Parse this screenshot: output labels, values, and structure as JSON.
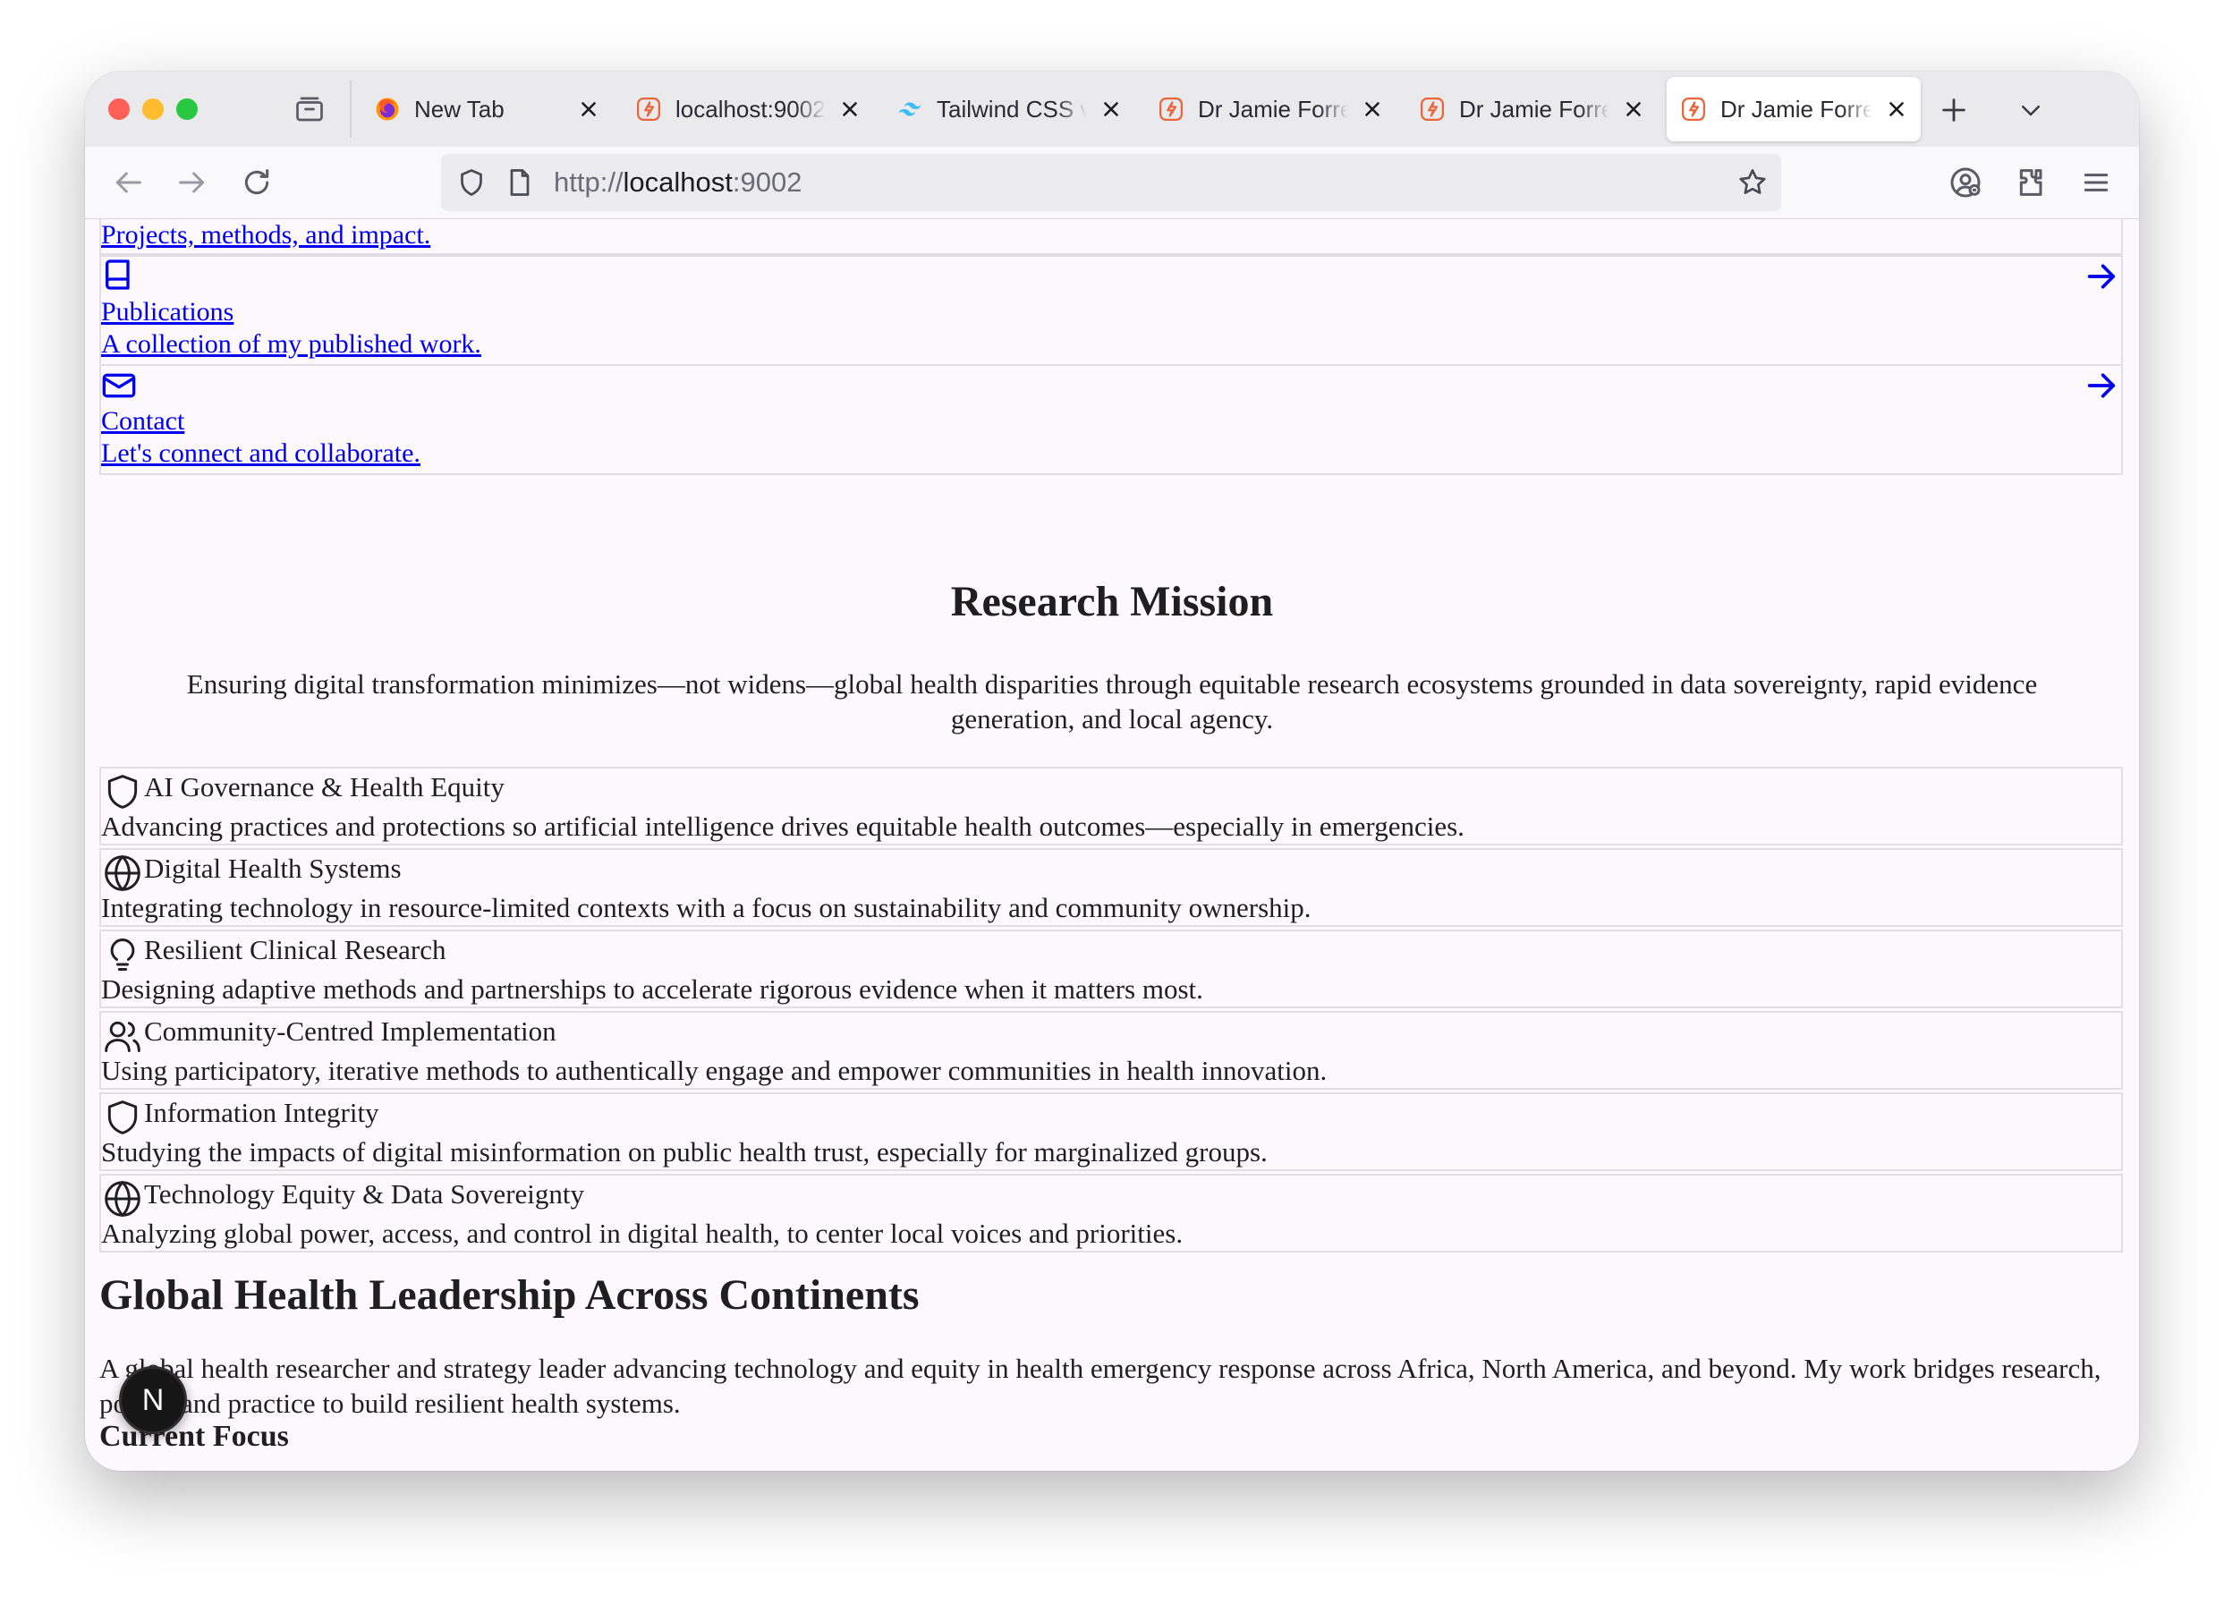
{
  "browser": {
    "tabs": [
      {
        "title": "New Tab",
        "icon": "firefox-icon",
        "active": false
      },
      {
        "title": "localhost:9002",
        "icon": "app-favicon",
        "active": false
      },
      {
        "title": "Tailwind CSS v",
        "icon": "tailwind-icon",
        "active": false
      },
      {
        "title": "Dr Jamie Forre",
        "icon": "app-favicon",
        "active": false
      },
      {
        "title": "Dr Jamie Forre",
        "icon": "app-favicon",
        "active": false
      },
      {
        "title": "Dr Jamie Forre",
        "icon": "app-favicon",
        "active": true
      }
    ],
    "url_scheme": "http://",
    "url_host": "localhost",
    "url_port": ":9002"
  },
  "page": {
    "nav_cards": [
      {
        "title": "",
        "description": "Projects, methods, and impact.",
        "icon": "partial-card",
        "arrow_icon": "arrow-right-icon"
      },
      {
        "title": "Publications",
        "description": "A collection of my published work.",
        "icon": "book-icon",
        "arrow_icon": "arrow-right-icon"
      },
      {
        "title": "Contact",
        "description": "Let's connect and collaborate.",
        "icon": "mail-icon",
        "arrow_icon": "arrow-right-icon"
      }
    ],
    "mission": {
      "heading": "Research Mission",
      "text": "Ensuring digital transformation minimizes—not widens—global health disparities through equitable research ecosystems grounded in data sovereignty, rapid evidence generation, and local agency."
    },
    "focus_areas": [
      {
        "title": "AI Governance & Health Equity",
        "description": "Advancing practices and protections so artificial intelligence drives equitable health outcomes—especially in emergencies.",
        "icon": "shield-icon"
      },
      {
        "title": "Digital Health Systems",
        "description": "Integrating technology in resource-limited contexts with a focus on sustainability and community ownership.",
        "icon": "globe-icon"
      },
      {
        "title": "Resilient Clinical Research",
        "description": "Designing adaptive methods and partnerships to accelerate rigorous evidence when it matters most.",
        "icon": "lightbulb-icon"
      },
      {
        "title": "Community-Centred Implementation",
        "description": "Using participatory, iterative methods to authentically engage and empower communities in health innovation.",
        "icon": "users-icon"
      },
      {
        "title": "Information Integrity",
        "description": "Studying the impacts of digital misinformation on public health trust, especially for marginalized groups.",
        "icon": "shield-icon"
      },
      {
        "title": "Technology Equity & Data Sovereignty",
        "description": "Analyzing global power, access, and control in digital health, to center local voices and priorities.",
        "icon": "globe-icon"
      }
    ],
    "leadership": {
      "heading": "Global Health Leadership Across Continents",
      "text": "A global health researcher and strategy leader advancing technology and equity in health emergency response across Africa, North America, and beyond. My work bridges research, policy, and practice to build resilient health systems."
    },
    "current_focus_heading": "Current Focus",
    "dev_badge_label": "N"
  }
}
